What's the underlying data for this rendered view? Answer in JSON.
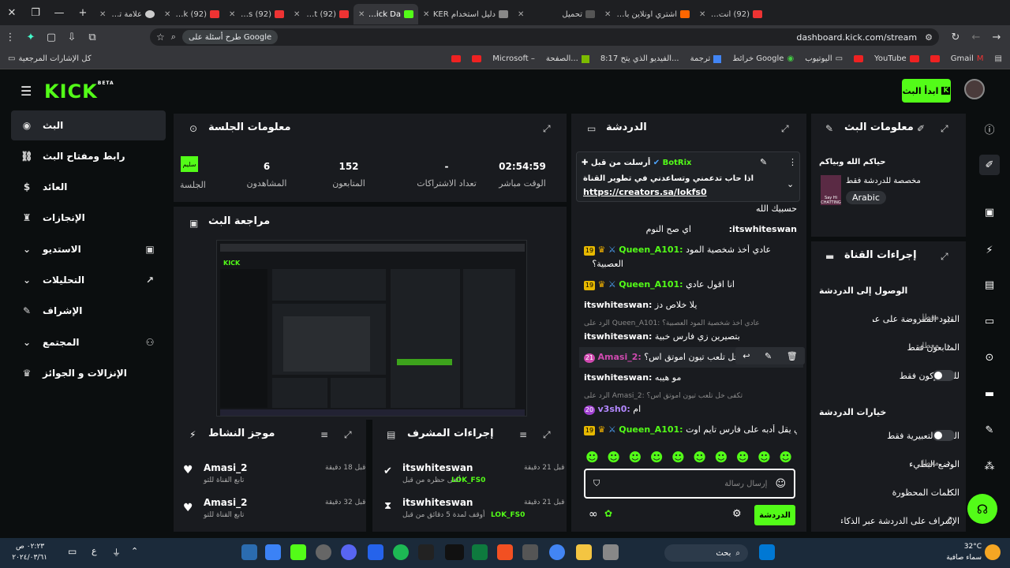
{
  "browser": {
    "tabs": [
      {
        "title": "(92) أنت طيب -"
      },
      {
        "title": "اشتري اونلاين بأفضل"
      },
      {
        "title": "تحميل"
      },
      {
        "title": "دليل استخدام KER"
      },
      {
        "title": "Stream - Kick Da"
      },
      {
        "title": "(92) Bôa - Duvet"
      },
      {
        "title": "(92) Al Compás"
      },
      {
        "title": "(92) L.K. Ft. Eirkk"
      },
      {
        "title": "علامة تبويب جديدة"
      }
    ],
    "google_pill": "طرح أسئلة على Google",
    "url": "dashboard.kick.com/stream",
    "bookmarks": [
      "Gmail",
      "",
      "YouTube",
      "",
      "اليوتيوب",
      "خرائط Google",
      "ترجمة",
      "8:17 الفيديو الذي يتح...",
      "الصفحة...",
      "Microsoft –",
      "",
      "",
      "كل الإشارات المرجعية"
    ]
  },
  "header": {
    "logo": "KICK",
    "beta": "BETA",
    "go_live": "ابدأ البث"
  },
  "sidebar": {
    "items": [
      {
        "label": "البث",
        "icon": "radio-icon"
      },
      {
        "label": "رابط ومفتاح البث",
        "icon": "link-icon"
      },
      {
        "label": "العائد",
        "icon": "dollar-icon"
      },
      {
        "label": "الإنجازات",
        "icon": "trophy-icon"
      },
      {
        "label": "الاستديو",
        "icon": "studio-icon"
      },
      {
        "label": "التحليلات",
        "icon": "chart-icon"
      },
      {
        "label": "الإشراف",
        "icon": "wrench-icon"
      },
      {
        "label": "المجتمع",
        "icon": "people-icon"
      },
      {
        "label": "الإنزالات و الجوائز",
        "icon": "crown-icon"
      }
    ]
  },
  "session": {
    "title": "معلومات الجلسة",
    "stats": [
      {
        "value": "02:54:59",
        "label": "الوقت مباشر"
      },
      {
        "value": "-",
        "label": "تعداد الاشتراكات"
      },
      {
        "value": "152",
        "label": "المتابعون"
      },
      {
        "value": "6",
        "label": "المشاهدون"
      },
      {
        "value": "سليم",
        "label": "الجلسة"
      }
    ]
  },
  "preview": {
    "title": "مراجعة البث"
  },
  "activity": {
    "title": "موجز النشاط",
    "items": [
      {
        "user": "Amasi_2",
        "time": "قبل 18 دقيقة",
        "desc": "تابع القناة للتو"
      },
      {
        "user": "Amasi_2",
        "time": "قبل 32 دقيقة",
        "desc": "تابع القناة للتو"
      }
    ]
  },
  "modactions": {
    "title": "إجراءات المشرف",
    "items": [
      {
        "user": "itswhiteswan",
        "time": "قبل 21 دقيقة",
        "desc": "ألغى حظره من قبل",
        "target": "LOK_FS0"
      },
      {
        "user": "itswhiteswan",
        "time": "قبل 21 دقيقة",
        "desc": "أوقف لمدة 5 دقائق من قبل",
        "target": "LOK_FS0"
      }
    ]
  },
  "chat": {
    "title": "الدردشة",
    "pinned": {
      "user": "BotRix",
      "sent_by": "أرسلت من قبل",
      "text": "اذا حاب تدعمني وتساعدني في تطوير القناة",
      "link": "https://creators.sa/lokfs0"
    },
    "messages": [
      {
        "user": "",
        "text": "حسبيك الله"
      },
      {
        "user": "itswhiteswan:",
        "text": "اي صح النوم"
      },
      {
        "user": "Queen_A101:",
        "text": "عادي أخذ شخصية المود",
        "badge": "19"
      },
      {
        "user": "",
        "text": "العصبية؟"
      },
      {
        "user": "Queen_A101:",
        "text": "انا اقول عادي",
        "badge": "19"
      },
      {
        "user": "itswhiteswan:",
        "text": "يلا خلاص دز"
      },
      {
        "user": "",
        "text": "الرد على Queen_A101: عادي أخذ شخصية المود العصبية؟"
      },
      {
        "user": "itswhiteswan:",
        "text": "بتصيرين زي فارس خبية"
      },
      {
        "user": "Amasi_2:",
        "text": "تكفى خل تلعب تيون اموتق اس؟",
        "badge": "21"
      },
      {
        "user": "itswhiteswan:",
        "text": "مو هيبه"
      },
      {
        "user": "",
        "text": "الرد على Amasi_2: تكفى خل تلعب تيون اموتق اس؟"
      },
      {
        "user": "v3sh0:",
        "text": "ام",
        "badge": "20"
      },
      {
        "user": "Queen_A101:",
        "text": "اللي يقل أدبه على فارس تايم اوت",
        "badge": "19"
      }
    ],
    "input_placeholder": "إرسال رسالة",
    "send": "الدردشة"
  },
  "streaminfo": {
    "title": "معلومات البث",
    "greeting": "حياكم الله وبياكم",
    "restriction": "مخصصة للدردشة فقط",
    "language": "Arabic",
    "avatar_text": "Say Hi CHATTING"
  },
  "channelactions": {
    "title": "إجراءات القناة",
    "section1": "الوصول إلى الدردشة",
    "rows1": [
      {
        "label": "القيود المفروضة على عمر...",
        "value": "معطل"
      },
      {
        "label": "المتابعون فقط",
        "value": "معطل"
      },
      {
        "label": "للمشتركون فقط",
        "value": ""
      }
    ],
    "section2": "خيارات الدردشة",
    "rows2": [
      {
        "label": "الصور التعبيرية فقط",
        "value": ""
      },
      {
        "label": "الوضع البطيء",
        "value": "معطل"
      },
      {
        "label": "الكلمات المحظورة",
        "value": ""
      },
      {
        "label": "الإشراف على الدردشة عبر الذكاء...",
        "value": ""
      }
    ]
  },
  "taskbar": {
    "time": "٠٢:٢٣ ص",
    "date": "٢٠٢٤/٠٣/٦١",
    "temp": "32°C",
    "weather": "سماء صافية",
    "search": "بحث",
    "lang": "ع"
  }
}
